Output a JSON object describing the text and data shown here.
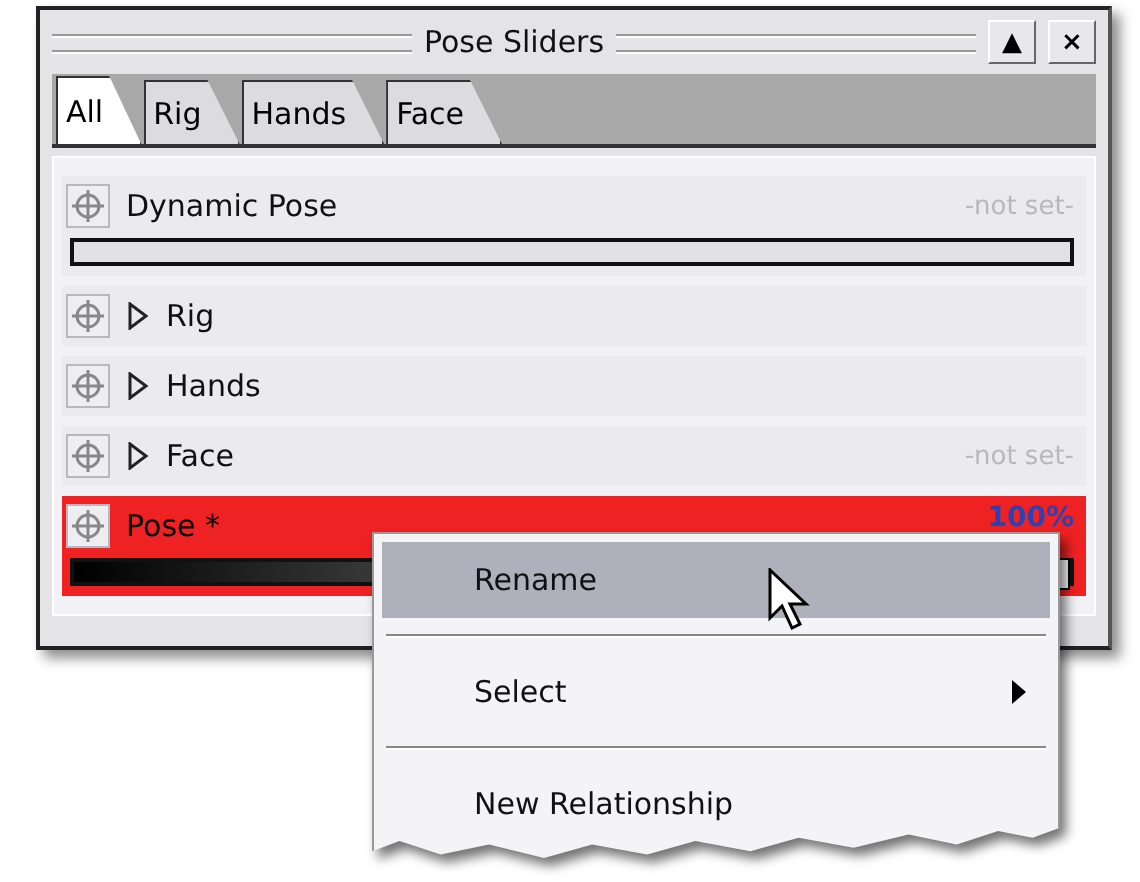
{
  "window": {
    "title": "Pose Sliders",
    "buttons": [
      "▲",
      "×"
    ]
  },
  "tabs": [
    {
      "label": "All",
      "selected": true
    },
    {
      "label": "Rig",
      "selected": false
    },
    {
      "label": "Hands",
      "selected": false
    },
    {
      "label": "Face",
      "selected": false
    }
  ],
  "rows": [
    {
      "kind": "slider",
      "name": "Dynamic Pose",
      "value": "-not set-",
      "selected": false,
      "level": 0
    },
    {
      "kind": "group",
      "name": "Rig",
      "expanded": false,
      "selected": false
    },
    {
      "kind": "group",
      "name": "Hands",
      "expanded": false,
      "selected": false
    },
    {
      "kind": "group",
      "name": "Face",
      "expanded": false,
      "value": "-not set-",
      "selected": false
    },
    {
      "kind": "slider",
      "name": "Pose *",
      "value": "100%",
      "selected": true,
      "level": 1
    }
  ],
  "context_menu": {
    "items": [
      {
        "kind": "item",
        "label": "Rename",
        "selected": true
      },
      {
        "kind": "item",
        "label": "Select",
        "selected": false,
        "submenu": true
      },
      {
        "kind": "item",
        "label": "New Relationship",
        "selected": false
      }
    ]
  }
}
